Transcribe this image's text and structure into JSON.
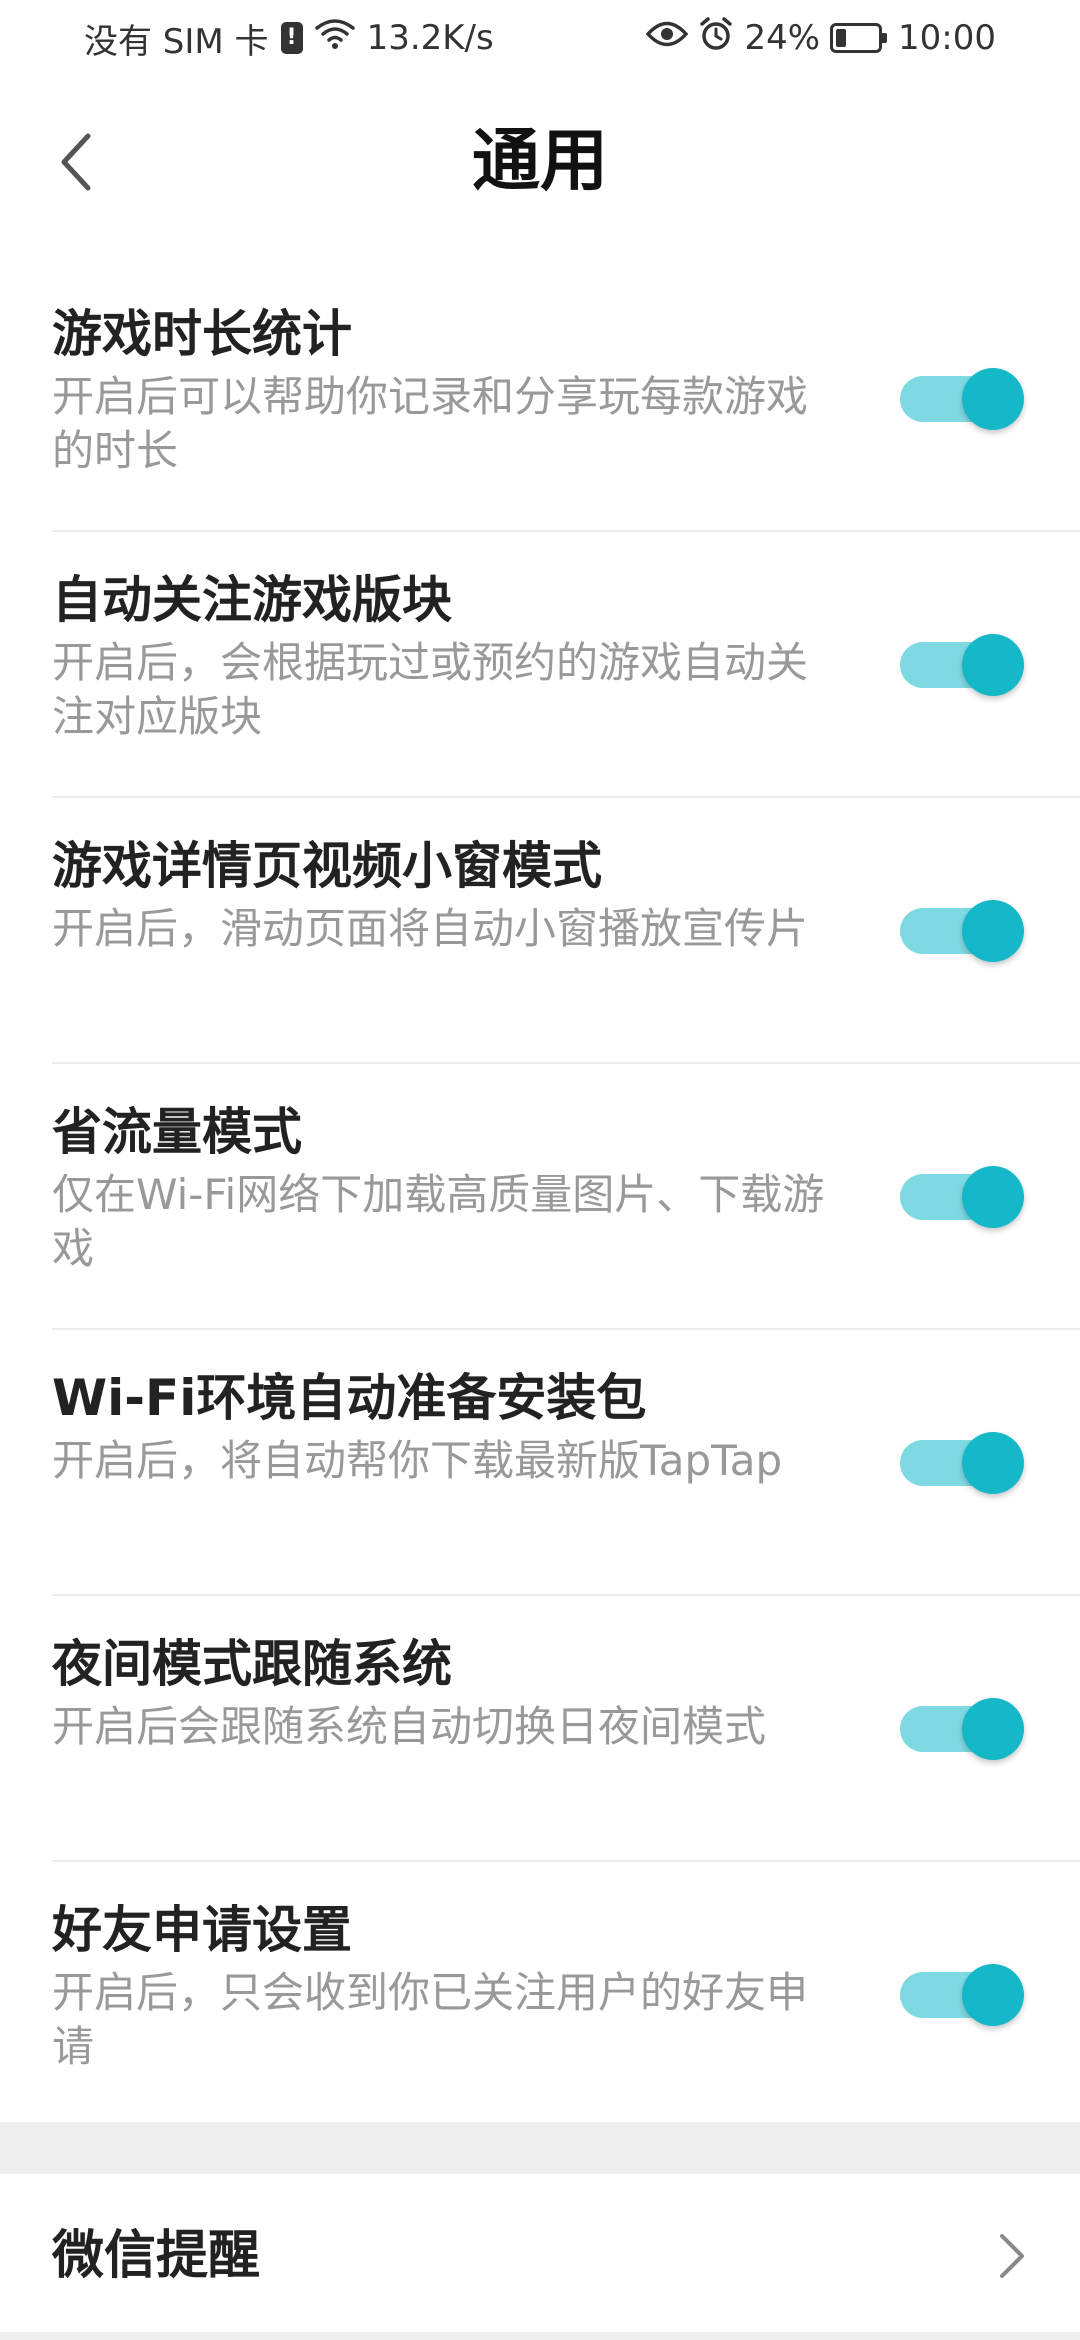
{
  "status_bar": {
    "carrier": "没有 SIM 卡",
    "sim_alert": "!",
    "network_speed": "13.2K/s",
    "battery": "24%",
    "battery_level": 0.24,
    "time": "10:00"
  },
  "header": {
    "title": "通用"
  },
  "settings": [
    {
      "title": "游戏时长统计",
      "desc": "开启后可以帮助你记录和分享玩每款游戏的时长",
      "enabled": true
    },
    {
      "title": "自动关注游戏版块",
      "desc": "开启后，会根据玩过或预约的游戏自动关注对应版块",
      "enabled": true
    },
    {
      "title": "游戏详情页视频小窗模式",
      "desc": "开启后，滑动页面将自动小窗播放宣传片",
      "enabled": true
    },
    {
      "title": "省流量模式",
      "desc": "仅在Wi-Fi网络下加载高质量图片、下载游戏",
      "enabled": true
    },
    {
      "title": "Wi-Fi环境自动准备安装包",
      "desc": "开启后，将自动帮你下载最新版TapTap",
      "enabled": true
    },
    {
      "title": "夜间模式跟随系统",
      "desc": "开启后会跟随系统自动切换日夜间模式",
      "enabled": true
    },
    {
      "title": "好友申请设置",
      "desc": "开启后，只会收到你已关注用户的好友申请",
      "enabled": true
    }
  ],
  "wechat": {
    "label": "微信提醒"
  },
  "colors": {
    "toggle_track": "#7fd9e2",
    "toggle_knob": "#15b8c9",
    "section_gap": "#efefef"
  }
}
